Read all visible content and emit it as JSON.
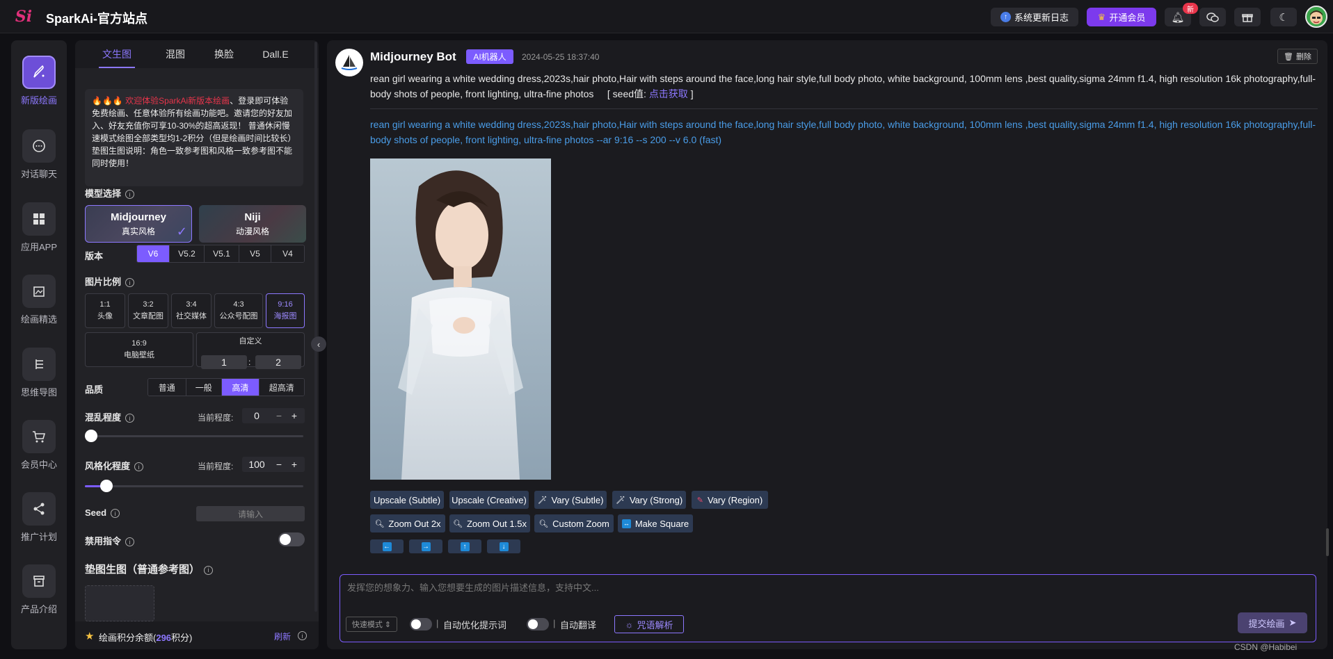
{
  "brand": {
    "logo_text": "Si",
    "title": "SparkAi-官方站点"
  },
  "topbar": {
    "changelog_label": "系统更新日志",
    "vip_label": "开通会员",
    "new_badge": "新"
  },
  "rail": [
    {
      "label": "新版绘画",
      "icon": "brush-icon",
      "active": true
    },
    {
      "label": "对话聊天",
      "icon": "chat-icon"
    },
    {
      "label": "应用APP",
      "icon": "apps-icon"
    },
    {
      "label": "绘画精选",
      "icon": "gallery-icon"
    },
    {
      "label": "思维导图",
      "icon": "mindmap-icon"
    },
    {
      "label": "会员中心",
      "icon": "cart-icon"
    },
    {
      "label": "推广计划",
      "icon": "share-icon"
    },
    {
      "label": "产品介绍",
      "icon": "box-icon"
    }
  ],
  "panel": {
    "tabs": [
      "文生图",
      "混图",
      "换脸",
      "Dall.E"
    ],
    "notice_highlight": "🔥🔥🔥 欢迎体验SparkAi新版本绘画",
    "notice_text": "、登录即可体验免费绘画、任意体验所有绘画功能吧。邀请您的好友加入、好友充值你可享10-30%的超高返现！ 普通休闲慢速模式绘图全部类型均1-2积分（但是绘画时间比较长）垫图生图说明：角色一致参考图和风格一致参考图不能同时使用！",
    "model_label": "模型选择",
    "models": [
      {
        "title": "Midjourney",
        "sub": "真实风格"
      },
      {
        "title": "Niji",
        "sub": "动漫风格"
      }
    ],
    "version_label": "版本",
    "versions": [
      "V6",
      "V5.2",
      "V5.1",
      "V5",
      "V4"
    ],
    "ratio_label": "图片比例",
    "ratios": [
      {
        "r": "1:1",
        "d": "头像"
      },
      {
        "r": "3:2",
        "d": "文章配图"
      },
      {
        "r": "3:4",
        "d": "社交媒体"
      },
      {
        "r": "4:3",
        "d": "公众号配图"
      },
      {
        "r": "9:16",
        "d": "海报图"
      }
    ],
    "ratio_wide": {
      "r": "16:9",
      "d": "电脑壁纸"
    },
    "custom": {
      "label": "自定义",
      "w": "1",
      "sep": ":",
      "h": "2"
    },
    "quality_label": "品质",
    "qualities": [
      "普通",
      "一般",
      "高清",
      "超高清"
    ],
    "chaos": {
      "label": "混乱程度",
      "current_label": "当前程度:",
      "value": "0",
      "fraction": 0.0
    },
    "stylize": {
      "label": "风格化程度",
      "current_label": "当前程度:",
      "value": "100",
      "fraction": 0.1
    },
    "seed": {
      "label": "Seed",
      "placeholder": "请输入"
    },
    "ban_label": "禁用指令",
    "ref_label": "垫图生图（普通参考图）",
    "footer": {
      "prefix": "绘画积分余额(",
      "points": "296",
      "suffix": "积分)",
      "refresh": "刷新"
    }
  },
  "message": {
    "bot_name": "Midjourney Bot",
    "tag": "AI机器人",
    "time": "2024-05-25 18:37:40",
    "delete_label": "删除",
    "prompt": "rean girl wearing a white wedding dress,2023s,hair photo,Hair with steps around the face,long hair style,full body photo, white background, 100mm lens ,best quality,sigma 24mm f1.4, high resolution 16k photography,full-body shots of people, front lighting, ultra-fine photos",
    "seed_prefix": "[ seed值: ",
    "seed_link": "点击获取",
    "seed_suffix": " ]",
    "full_prompt": "rean girl wearing a white wedding dress,2023s,hair photo,Hair with steps around the face,long hair style,full body photo, white background, 100mm lens ,best quality,sigma 24mm f1.4, high resolution 16k photography,full-body shots of people, front lighting, ultra-fine photos --ar 9:16 --s 200 --v 6.0  (fast)",
    "row1": [
      "Upscale (Subtle)",
      "Upscale (Creative)",
      "Vary (Subtle)",
      "Vary (Strong)",
      "Vary (Region)"
    ],
    "row2": [
      "Zoom Out 2x",
      "Zoom Out 1.5x",
      "Custom Zoom",
      "Make Square"
    ]
  },
  "input": {
    "placeholder": "发挥您的想象力、输入您想要生成的图片描述信息，支持中文...",
    "mode": "快速模式 ⇕",
    "auto_optimize": "自动优化提示词",
    "auto_translate": "自动翻译",
    "parse": "咒语解析",
    "submit": "提交绘画"
  },
  "watermark": "CSDN @Habibei"
}
